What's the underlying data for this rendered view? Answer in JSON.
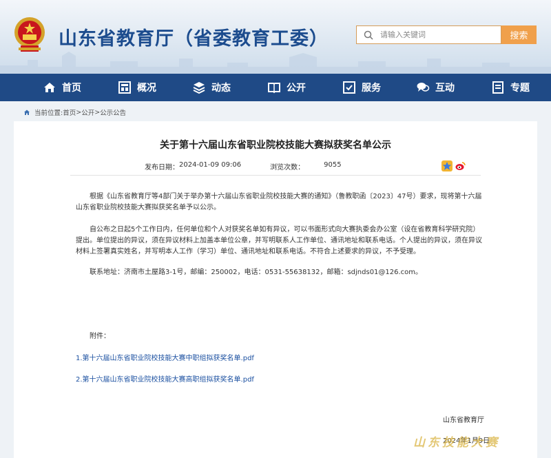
{
  "header": {
    "title": "山东省教育厅（省委教育工委）",
    "search_placeholder": "请输入关键词",
    "search_button": "搜索"
  },
  "nav": [
    {
      "label": "首页",
      "icon": "home-icon"
    },
    {
      "label": "概况",
      "icon": "overview-icon"
    },
    {
      "label": "动态",
      "icon": "news-icon"
    },
    {
      "label": "公开",
      "icon": "book-icon"
    },
    {
      "label": "服务",
      "icon": "service-icon"
    },
    {
      "label": "互动",
      "icon": "chat-icon"
    },
    {
      "label": "专题",
      "icon": "topic-icon"
    }
  ],
  "breadcrumb": {
    "prefix": "当前位置:",
    "items": [
      "首页",
      "公开",
      "公示公告"
    ],
    "separator": " > "
  },
  "article": {
    "title": "关于第十六届山东省职业院校技能大赛拟获奖名单公示",
    "publish_label": "发布日期：",
    "publish_date": "2024-01-09 09:06",
    "views_label": "浏览次数：",
    "views": "9055",
    "paragraphs": [
      "根据《山东省教育厅等4部门关于举办第十六届山东省职业院校技能大赛的通知》（鲁教职函〔2023〕47号）要求，现将第十六届山东省职业院校技能大赛拟获奖名单予以公示。",
      "自公布之日起5个工作日内，任何单位和个人对获奖名单如有异议，可以书面形式向大赛执委会办公室（设在省教育科学研究院）提出。单位提出的异议，须在异议材料上加盖本单位公章，并写明联系人工作单位、通讯地址和联系电话。个人提出的异议，须在异议材料上签署真实姓名，并写明本人工作（学习）单位、通讯地址和联系电话。不符合上述要求的异议，不予受理。",
      "联系地址：济南市土屋路3-1号，邮编：250002，电话：0531-55638132，邮箱：sdjnds01@126.com。"
    ],
    "attachments_label": "附件：",
    "attachments": [
      "1.第十六届山东省职业院校技能大赛中职组拟获奖名单.pdf",
      "2.第十六届山东省职业院校技能大赛高职组拟获奖名单.pdf"
    ],
    "signature": "山东省教育厅",
    "sign_date": "2024年1月9日"
  },
  "watermark": "山东技能大赛",
  "colors": {
    "nav_bg": "#1f4a86",
    "title_blue": "#1c4c8e",
    "search_orange": "#f0a04b",
    "link_blue": "#1a4fa0"
  }
}
